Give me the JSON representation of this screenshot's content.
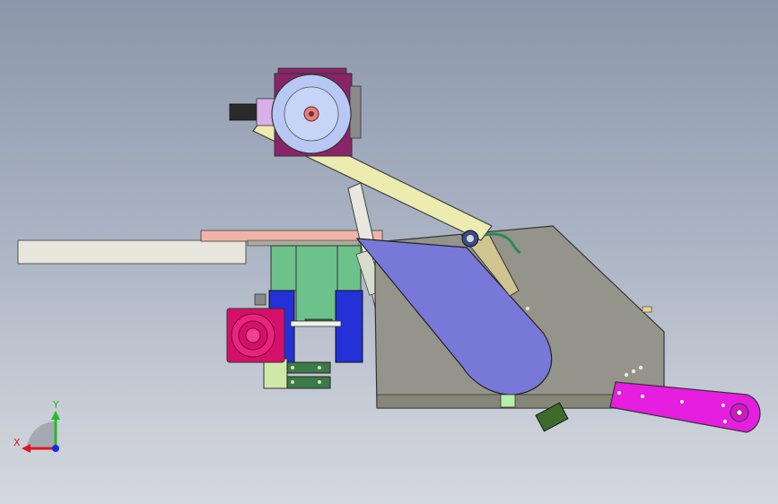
{
  "triad": {
    "x_label": "X",
    "y_label": "Y",
    "x_color": "#e8141c",
    "y_color": "#1fbf1f",
    "z_color": "#1a2ae0"
  },
  "colors": {
    "plate": "#e6e6dc",
    "pink_bar": "#f0b4a8",
    "green_block": "#6cc28a",
    "blue_block": "#2430d8",
    "magenta": "#d4106a",
    "body_gray": "#94948a",
    "cone_blue": "#7878d8",
    "yellow_arm": "#ecebb0",
    "magenta_arm": "#e61ee0",
    "wheel_blue": "#b8c8f4"
  }
}
